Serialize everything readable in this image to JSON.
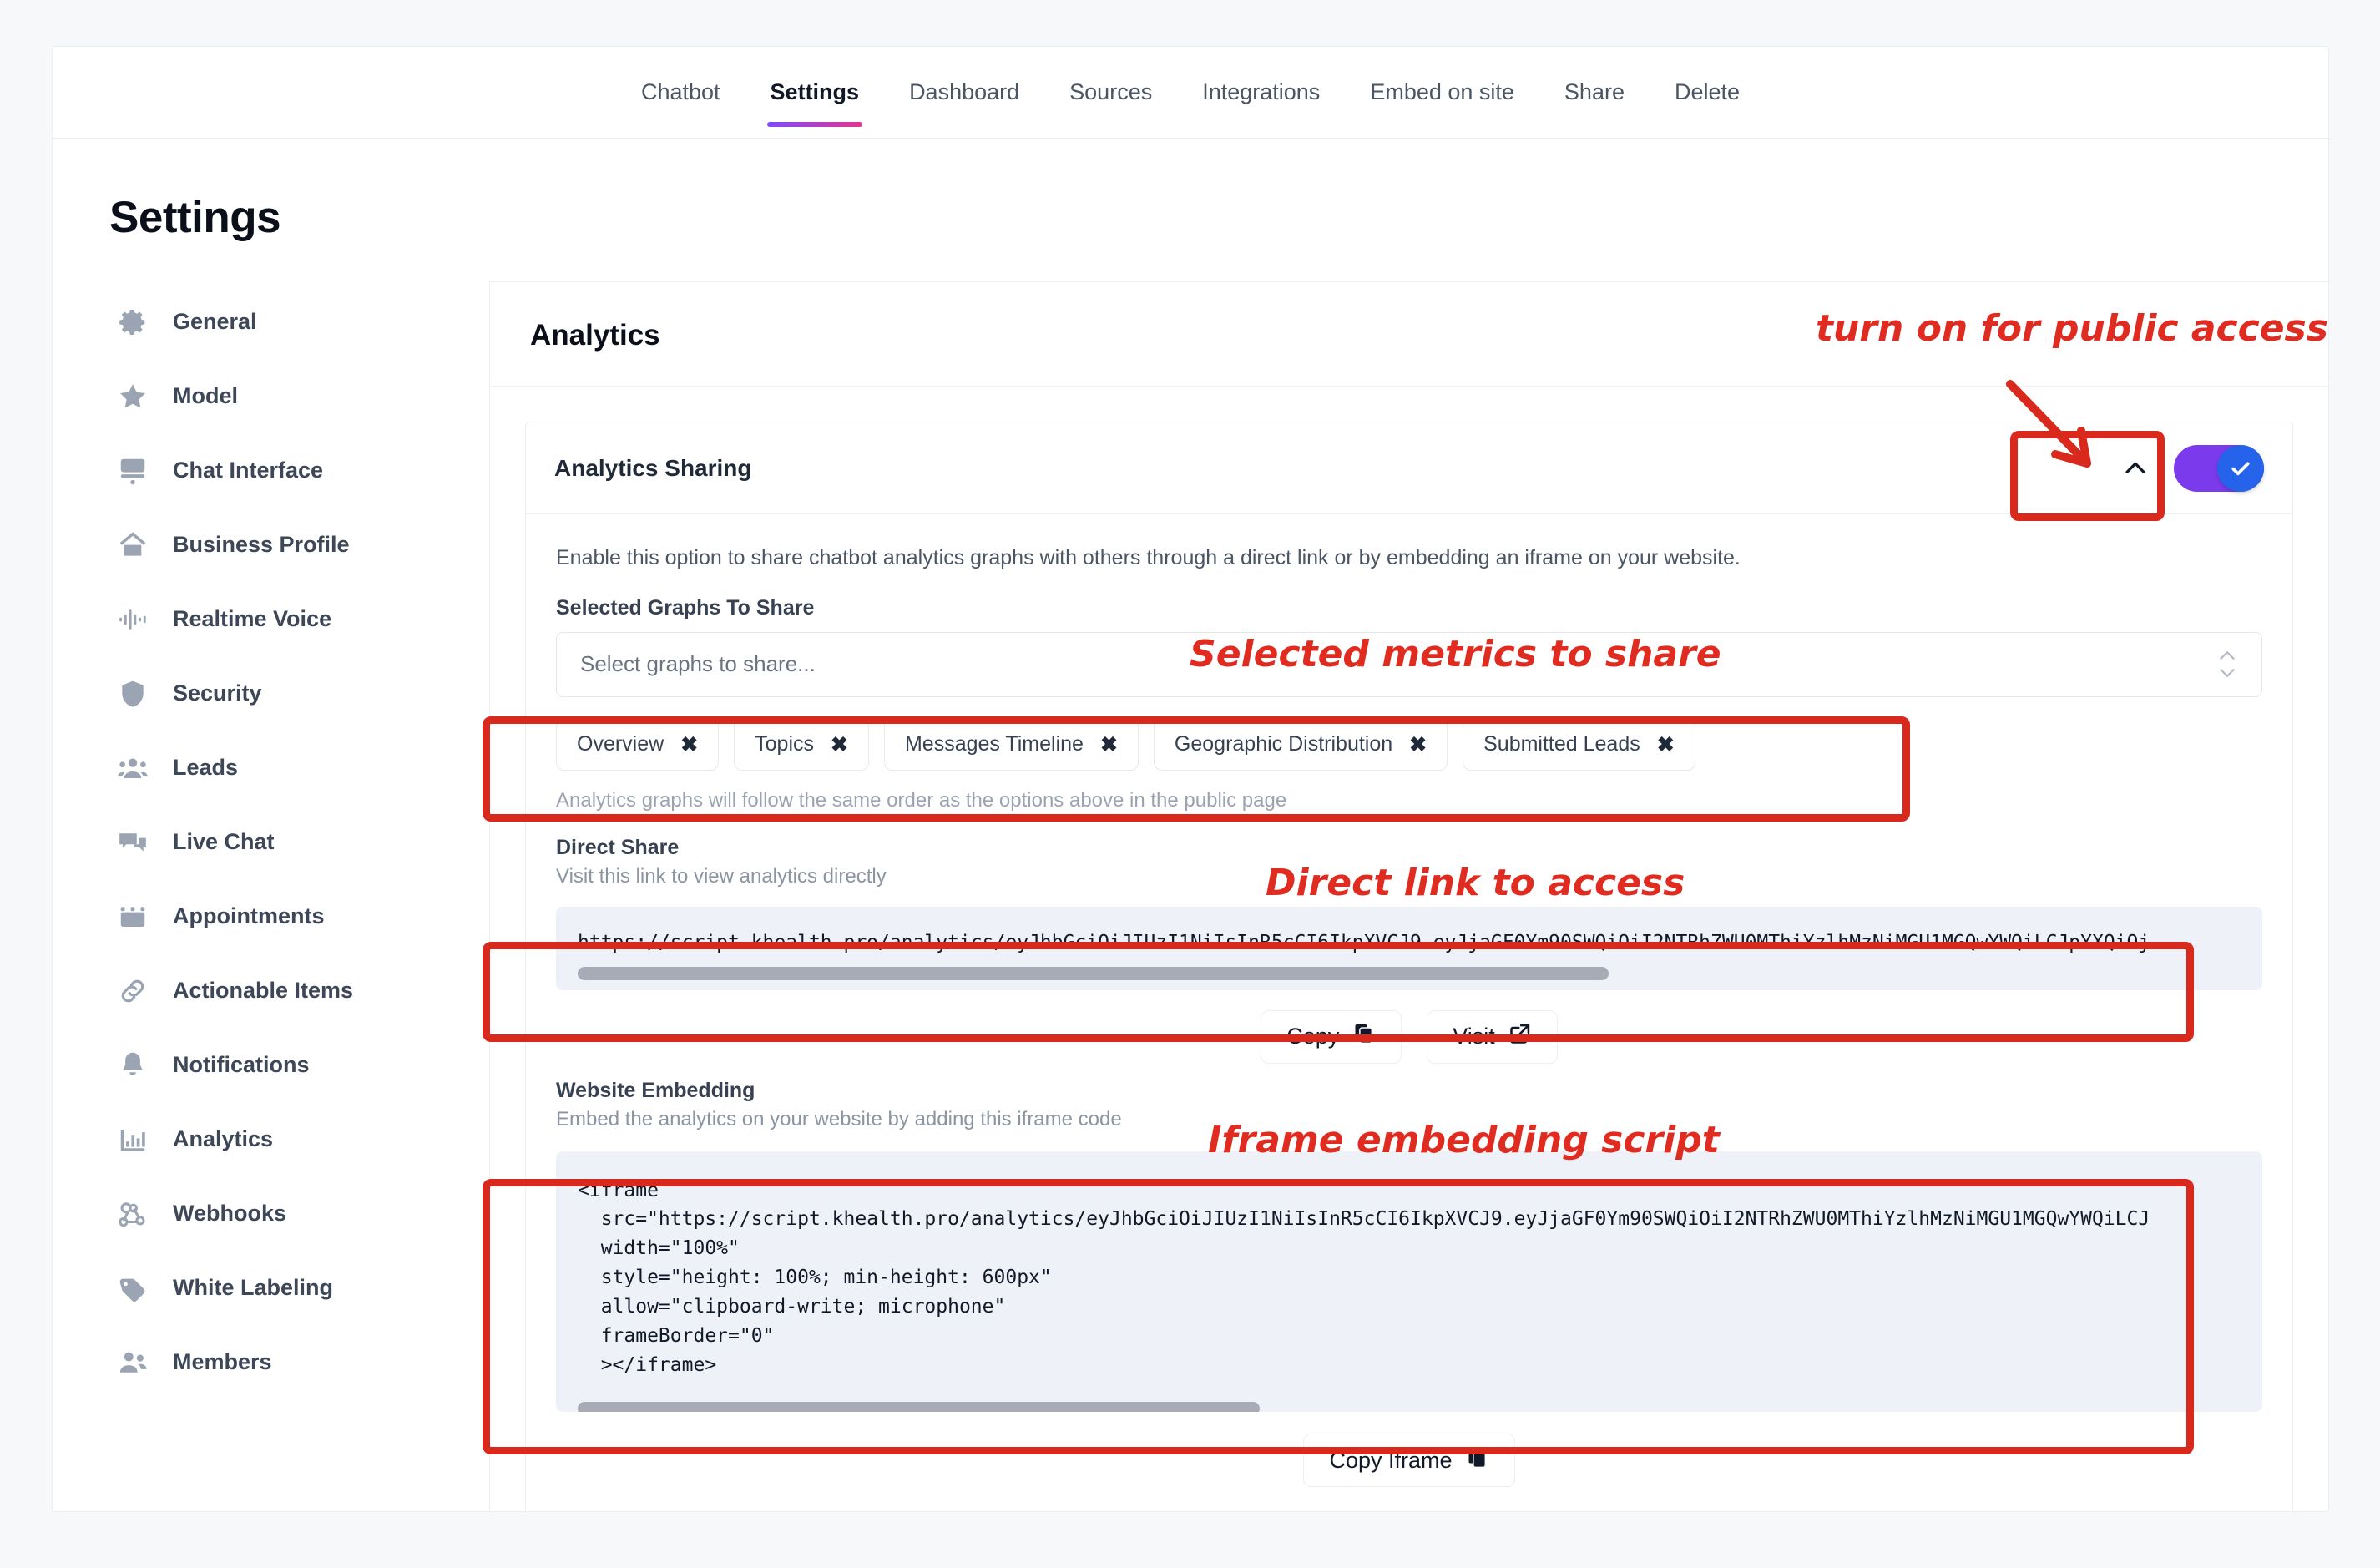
{
  "topnav": {
    "items": [
      {
        "label": "Chatbot",
        "active": false
      },
      {
        "label": "Settings",
        "active": true
      },
      {
        "label": "Dashboard",
        "active": false
      },
      {
        "label": "Sources",
        "active": false
      },
      {
        "label": "Integrations",
        "active": false
      },
      {
        "label": "Embed on site",
        "active": false
      },
      {
        "label": "Share",
        "active": false
      },
      {
        "label": "Delete",
        "active": false
      }
    ]
  },
  "page": {
    "title": "Settings"
  },
  "sidebar": {
    "items": [
      {
        "label": "General",
        "icon": "gear-icon"
      },
      {
        "label": "Model",
        "icon": "star-icon"
      },
      {
        "label": "Chat Interface",
        "icon": "chat-window-icon"
      },
      {
        "label": "Business Profile",
        "icon": "home-icon"
      },
      {
        "label": "Realtime Voice",
        "icon": "waveform-icon"
      },
      {
        "label": "Security",
        "icon": "shield-icon"
      },
      {
        "label": "Leads",
        "icon": "users-group-icon"
      },
      {
        "label": "Live Chat",
        "icon": "chat-bubbles-icon"
      },
      {
        "label": "Appointments",
        "icon": "calendar-icon"
      },
      {
        "label": "Actionable Items",
        "icon": "link-chain-icon"
      },
      {
        "label": "Notifications",
        "icon": "bell-icon"
      },
      {
        "label": "Analytics",
        "icon": "bar-chart-icon"
      },
      {
        "label": "Webhooks",
        "icon": "webhook-icon"
      },
      {
        "label": "White Labeling",
        "icon": "tag-icon"
      },
      {
        "label": "Members",
        "icon": "people-icon"
      }
    ]
  },
  "panel": {
    "title": "Analytics",
    "accordion": {
      "title": "Analytics Sharing",
      "toggle_on": true,
      "collapse_icon": "chevron-up-icon",
      "description": "Enable this option to share chatbot analytics graphs with others through a direct link or by embedding an iframe on your website.",
      "select": {
        "label": "Selected Graphs To Share",
        "placeholder": "Select graphs to share...",
        "spinner_icon": "chevron-up-down-icon"
      },
      "tags": [
        "Overview",
        "Topics",
        "Messages Timeline",
        "Geographic Distribution",
        "Submitted Leads"
      ],
      "tag_remove_glyph": "✖",
      "order_note": "Analytics graphs will follow the same order as the options above in the public page",
      "direct_share": {
        "label": "Direct Share",
        "hint": "Visit this link to view analytics directly",
        "url": "https://script.khealth.pro/analytics/eyJhbGciOiJIUzI1NiIsInR5cCI6IkpXVCJ9.eyJjaGF0Ym90SWQiOiI2NTRhZWU0MThiYzlhMzNiMGU1MGQwYWQiLCJpYXQiOj",
        "copy_label": "Copy",
        "copy_icon": "copy-icon",
        "visit_label": "Visit",
        "visit_icon": "external-link-icon"
      },
      "website_embedding": {
        "label": "Website Embedding",
        "hint": "Embed the analytics on your website by adding this iframe code",
        "code": "<iframe\n  src=\"https://script.khealth.pro/analytics/eyJhbGciOiJIUzI1NiIsInR5cCI6IkpXVCJ9.eyJjaGF0Ym90SWQiOiI2NTRhZWU0MThiYzlhMzNiMGU1MGQwYWQiLCJ\n  width=\"100%\"\n  style=\"height: 100%; min-height: 600px\"\n  allow=\"clipboard-write; microphone\"\n  frameBorder=\"0\"\n  ></iframe>",
        "copy_iframe_label": "Copy Iframe",
        "copy_iframe_icon": "copy-icon"
      }
    }
  },
  "annotations": {
    "toggle_note": "turn on for public access",
    "metrics_note": "Selected metrics to share",
    "link_note": "Direct link to access",
    "iframe_note": "Iframe embedding script",
    "color": "#d9281c"
  }
}
